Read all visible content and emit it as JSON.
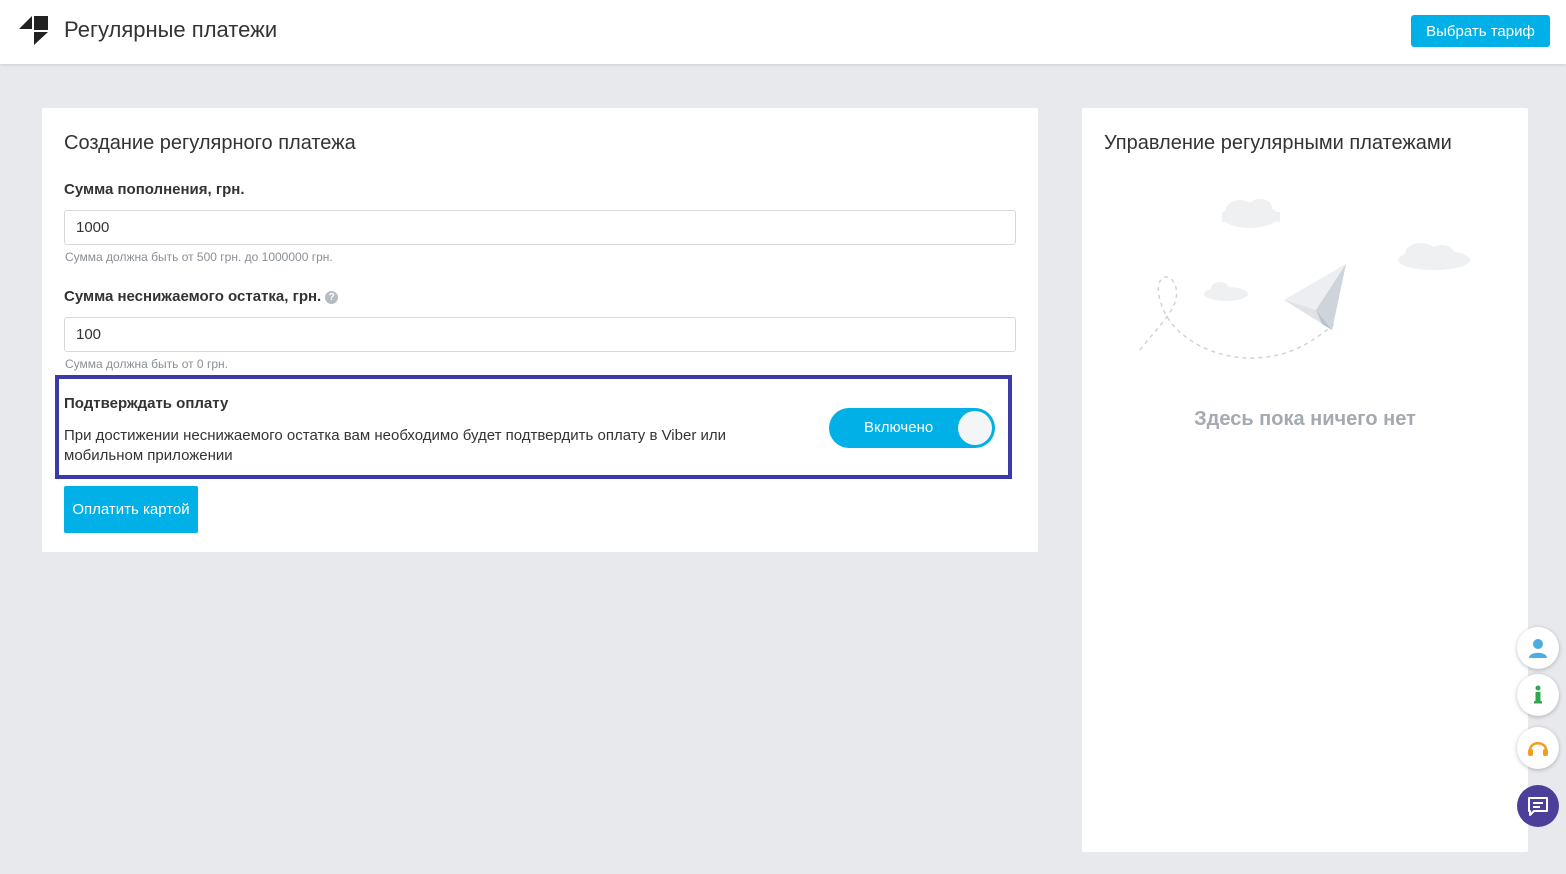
{
  "header": {
    "title": "Регулярные платежи",
    "tariff_button": "Выбрать тариф"
  },
  "create_form": {
    "title": "Создание регулярного платежа",
    "topup": {
      "label": "Сумма пополнения, грн.",
      "value": "1000",
      "hint": "Сумма должна быть от 500 грн. до 1000000 грн."
    },
    "minimum": {
      "label": "Сумма неснижаемого остатка, грн.",
      "help": "?",
      "value": "100",
      "hint": "Сумма должна быть от 0 грн."
    },
    "confirm": {
      "title": "Подтверждать оплату",
      "description": "При достижении неснижаемого остатка вам необходимо будет подтвердить оплату в Viber или мобильном приложении",
      "toggle_label": "Включено",
      "enabled": true
    },
    "pay_button": "Оплатить картой"
  },
  "manage": {
    "title": "Управление регулярными платежами",
    "empty_text": "Здесь пока ничего нет"
  },
  "side_buttons": [
    {
      "icon": "user-icon",
      "color": "#4aaee0"
    },
    {
      "icon": "info-icon",
      "color": "#2fa84f"
    },
    {
      "icon": "headset-icon",
      "color": "#f39c1e"
    },
    {
      "icon": "chat-icon",
      "color": "#4b3f9a"
    }
  ],
  "colors": {
    "accent": "#00b0e6",
    "highlight_border": "#3b3aa8",
    "background": "#e8e9ed"
  }
}
